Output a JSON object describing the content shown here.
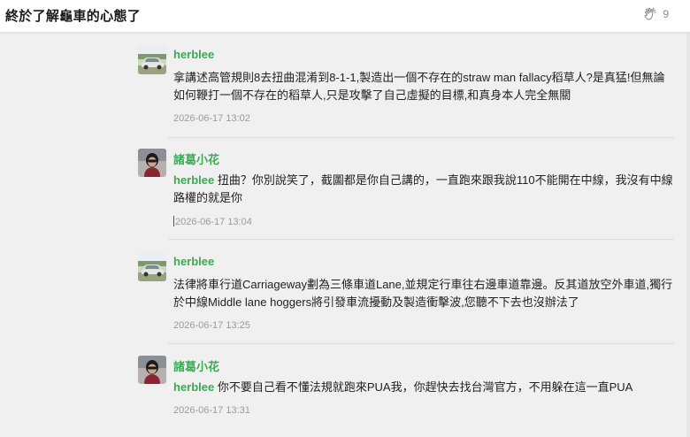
{
  "header": {
    "title": "終於了解龜車的心態了",
    "clap_icon": "clap-hands-icon",
    "clap_count": "9"
  },
  "comments": [
    {
      "author": "herblee",
      "avatar": "car-avatar",
      "reply_to": "",
      "body": "拿講述高管規則8去扭曲混淆到8-1-1,製造出一個不存在的straw man fallacy稻草人?是真猛!但無論如何鞭打一個不存在的稻草人,只是攻擊了自己虛擬的目標,和真身本人完全無關",
      "time": "2026-06-17 13:02"
    },
    {
      "author": "諸葛小花",
      "avatar": "person-avatar",
      "reply_to": "herblee",
      "body": "扭曲？你別說笑了，截圖都是你自己講的，一直跑來跟我說110不能開在中線，我沒有中線路權的就是你",
      "time": "2026-06-17 13:04"
    },
    {
      "author": "herblee",
      "avatar": "car-avatar",
      "reply_to": "",
      "body": "法律將車行道Carriageway劃為三條車道Lane,並規定行車往右邊車道靠邊。反其道放空外車道,獨行於中線Middle lane hoggers將引發車流擾動及製造衝擊波,您聽不下去也沒辦法了",
      "time": "2026-06-17 13:25"
    },
    {
      "author": "諸葛小花",
      "avatar": "person-avatar",
      "reply_to": "herblee",
      "body": "你不要自己看不懂法規就跑來PUA我，你趕快去找台灣官方，不用躲在這一直PUA",
      "time": "2026-06-17 13:31"
    }
  ]
}
